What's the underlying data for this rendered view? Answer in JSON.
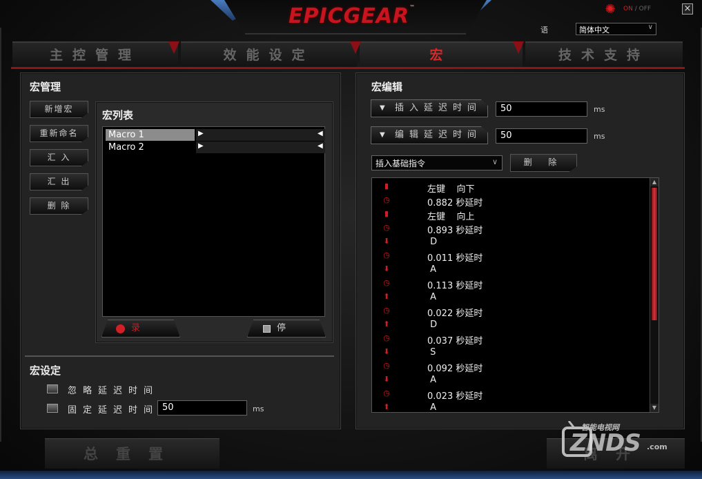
{
  "app": {
    "brand": "EPICGEAR",
    "trademark": "™",
    "power": {
      "on": "ON",
      "sep": "/",
      "off": "OFF"
    },
    "close": "×",
    "language": {
      "label": "语 言",
      "value": "简体中文"
    }
  },
  "tabs": [
    {
      "label": "主控管理",
      "active": false
    },
    {
      "label": "效能设定",
      "active": false
    },
    {
      "label": "宏",
      "active": true
    },
    {
      "label": "技术支持",
      "active": false
    }
  ],
  "macro_manage": {
    "title": "宏管理",
    "buttons": {
      "new": "新增宏",
      "rename": "重新命名",
      "import": "汇 入",
      "export": "汇 出",
      "delete": "删 除"
    }
  },
  "macro_list": {
    "title": "宏列表",
    "items": [
      {
        "name": "Macro 1",
        "selected": true
      },
      {
        "name": "Macro 2",
        "selected": false
      }
    ],
    "record": "录 制",
    "stop": "停 止"
  },
  "macro_settings": {
    "title": "宏设定",
    "ignore_delay": "忽略延迟时间",
    "fixed_delay": "固定延迟时间",
    "fixed_delay_value": "50",
    "unit": "ms"
  },
  "macro_edit": {
    "title": "宏编辑",
    "insert_delay_label": "插入延迟时间",
    "insert_delay_value": "50",
    "edit_delay_label": "编辑延迟时间",
    "edit_delay_value": "50",
    "unit": "ms",
    "command_select": "插入基础指令",
    "delete": "删 除",
    "events": [
      {
        "icon": "mouse-icon",
        "glyph": "▮",
        "text": "左键    向下"
      },
      {
        "icon": "clock-icon",
        "glyph": "◷",
        "text": "0.882 秒延时"
      },
      {
        "icon": "mouse-icon",
        "glyph": "▮",
        "text": "左键    向上"
      },
      {
        "icon": "clock-icon",
        "glyph": "◷",
        "text": "0.893 秒延时"
      },
      {
        "icon": "arrow-down-icon",
        "glyph": "⬇",
        "text": " D"
      },
      {
        "icon": "clock-icon",
        "glyph": "◷",
        "text": "0.011 秒延时"
      },
      {
        "icon": "arrow-down-icon",
        "glyph": "⬇",
        "text": " A"
      },
      {
        "icon": "clock-icon",
        "glyph": "◷",
        "text": "0.113 秒延时"
      },
      {
        "icon": "arrow-up-icon",
        "glyph": "⬆",
        "text": " A"
      },
      {
        "icon": "clock-icon",
        "glyph": "◷",
        "text": "0.022 秒延时"
      },
      {
        "icon": "arrow-up-icon",
        "glyph": "⬆",
        "text": " D"
      },
      {
        "icon": "clock-icon",
        "glyph": "◷",
        "text": "0.037 秒延时"
      },
      {
        "icon": "arrow-down-icon",
        "glyph": "⬇",
        "text": " S"
      },
      {
        "icon": "clock-icon",
        "glyph": "◷",
        "text": "0.092 秒延时"
      },
      {
        "icon": "arrow-down-icon",
        "glyph": "⬇",
        "text": " A"
      },
      {
        "icon": "clock-icon",
        "glyph": "◷",
        "text": "0.023 秒延时"
      },
      {
        "icon": "arrow-up-icon",
        "glyph": "⬆",
        "text": " A"
      }
    ]
  },
  "footer": {
    "reset": "总重置",
    "leave": "离开"
  },
  "watermark": {
    "cn": "智能电视网",
    "en": "ZNDS",
    "com": ".com"
  },
  "colors": {
    "accent": "#d42a2a",
    "panel": "#232323",
    "background": "#141414"
  }
}
